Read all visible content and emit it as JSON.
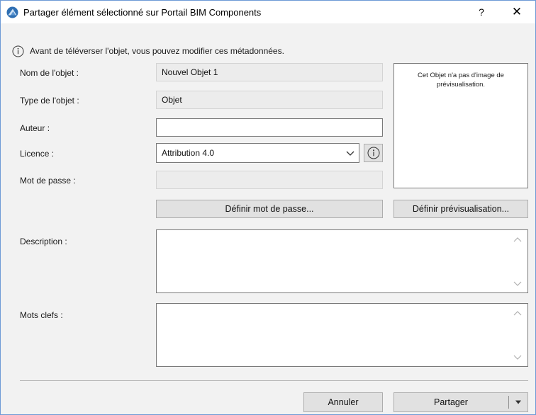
{
  "window": {
    "title": "Partager élément sélectionné sur Portail BIM Components",
    "help_label": "?",
    "close_label": "✕",
    "accent_color": "#2f6fb3"
  },
  "info": {
    "icon": "info-circle-icon",
    "text": "Avant de téléverser l'objet, vous pouvez modifier ces métadonnées."
  },
  "form": {
    "name_label": "Nom de l'objet :",
    "name_value": "Nouvel Objet 1",
    "type_label": "Type de l'objet :",
    "type_value": "Objet",
    "author_label": "Auteur :",
    "author_value": "",
    "license_label": "Licence :",
    "license_value": "Attribution 4.0",
    "password_label": "Mot de passe :",
    "password_value": "",
    "set_password_button": "Définir mot de passe...",
    "description_label": "Description :",
    "description_value": "",
    "keywords_label": "Mots clefs :",
    "keywords_value": ""
  },
  "preview": {
    "text": "Cet Objet n'a pas d'image de prévisualisation.",
    "set_preview_button": "Définir prévisualisation..."
  },
  "footer": {
    "cancel_button": "Annuler",
    "share_button": "Partager"
  }
}
